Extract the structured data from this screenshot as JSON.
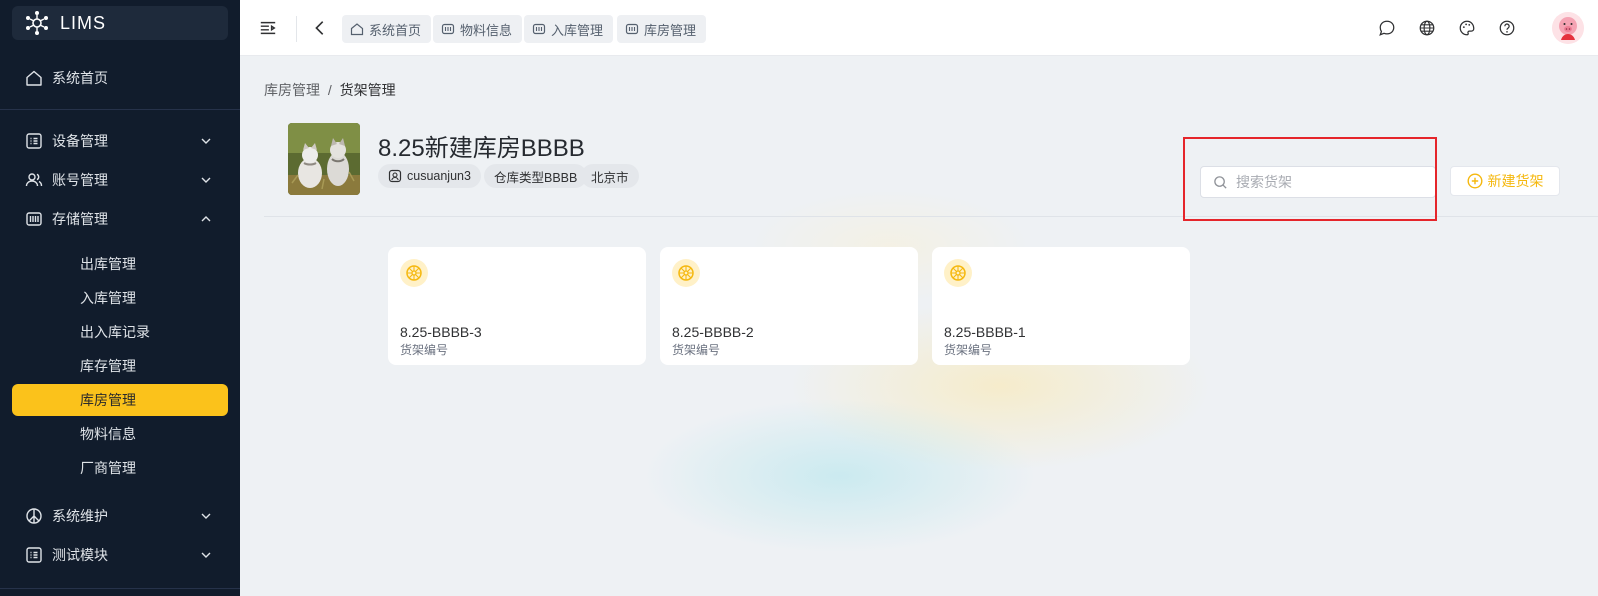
{
  "app": {
    "title": "LIMS"
  },
  "sidebar": {
    "home": "系统首页",
    "groups": [
      {
        "label": "设备管理",
        "icon": "grid-icon",
        "expanded": false
      },
      {
        "label": "账号管理",
        "icon": "users-icon",
        "expanded": false
      },
      {
        "label": "存储管理",
        "icon": "storage-icon",
        "expanded": true
      }
    ],
    "storage_items": [
      {
        "label": "出库管理"
      },
      {
        "label": "入库管理"
      },
      {
        "label": "出入库记录"
      },
      {
        "label": "库存管理"
      },
      {
        "label": "库房管理",
        "active": true
      },
      {
        "label": "物料信息"
      },
      {
        "label": "厂商管理"
      }
    ],
    "bottom_groups": [
      {
        "label": "系统维护",
        "icon": "peace-icon"
      },
      {
        "label": "测试模块",
        "icon": "grid-icon"
      }
    ]
  },
  "header": {
    "tabs": [
      {
        "label": "系统首页",
        "icon": "home-icon"
      },
      {
        "label": "物料信息",
        "icon": "box-icon"
      },
      {
        "label": "入库管理",
        "icon": "box-icon"
      },
      {
        "label": "库房管理",
        "icon": "box-icon"
      }
    ],
    "right_icons": [
      "chat-icon",
      "globe-icon",
      "palette-icon",
      "help-icon"
    ]
  },
  "breadcrumb": {
    "parent": "库房管理",
    "separator": "/",
    "current": "货架管理"
  },
  "warehouse": {
    "name": "8.25新建库房BBBB",
    "chips": [
      {
        "label": "cusuanjun3",
        "icon": "user-badge-icon"
      },
      {
        "label": "仓库类型BBBB"
      },
      {
        "label": "北京市"
      }
    ]
  },
  "search": {
    "placeholder": "搜索货架",
    "value": ""
  },
  "new_button": {
    "label": "新建货架"
  },
  "shelves": [
    {
      "name": "8.25-BBBB-3",
      "sub": "货架编号"
    },
    {
      "name": "8.25-BBBB-2",
      "sub": "货架编号"
    },
    {
      "name": "8.25-BBBB-1",
      "sub": "货架编号"
    }
  ],
  "colors": {
    "accent": "#fbc21b",
    "sidebar_bg": "#111c2c",
    "highlight_box": "#e5252a"
  }
}
